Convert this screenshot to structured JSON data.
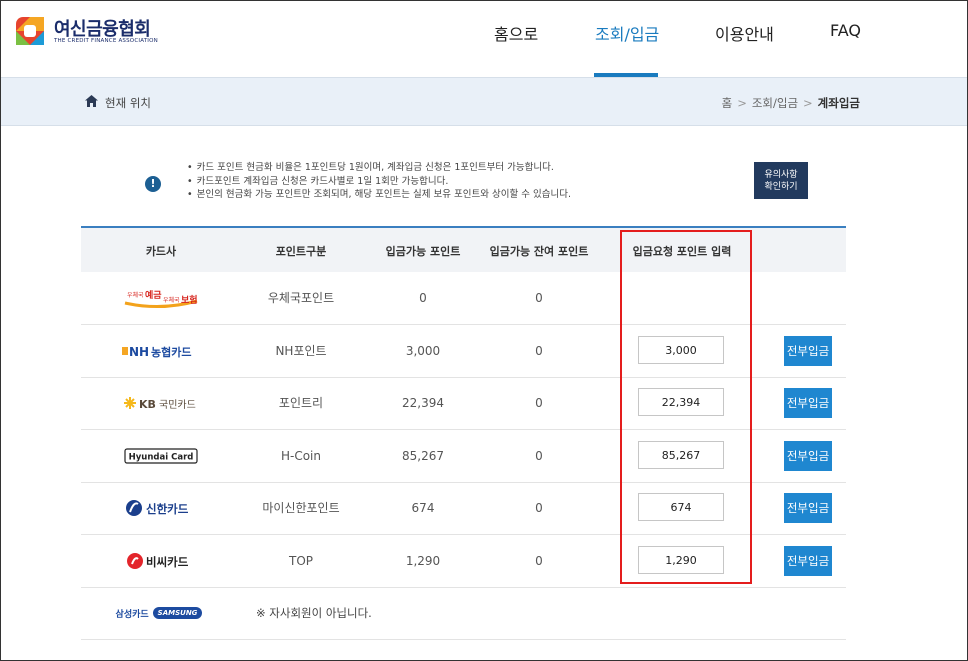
{
  "header": {
    "logo_text": "여신금융협회",
    "logo_sub": "THE CREDIT FINANCE ASSOCIATION",
    "nav": [
      {
        "label": "홈으로",
        "active": false
      },
      {
        "label": "조회/입금",
        "active": true
      },
      {
        "label": "이용안내",
        "active": false
      },
      {
        "label": "FAQ",
        "active": false
      }
    ],
    "accent_color": "#1a7bbf"
  },
  "breadcrumb": {
    "label": "현재 위치",
    "path": [
      "홈",
      "조회/입금",
      "계좌입금"
    ]
  },
  "notice": {
    "items": [
      "카드 포인트 현금화 비율은 1포인트당 1원이며, 계좌입금 신청은 1포인트부터 가능합니다.",
      "카드포인트 계좌입금 신청은 카드사별로 1일 1회만 가능합니다.",
      "본인의 현금화 가능 포인트만 조회되며, 해당 포인트는 실제 보유 포인트와 상이할 수 있습니다."
    ],
    "button_line1": "유의사항",
    "button_line2": "확인하기"
  },
  "table": {
    "headers": [
      "카드사",
      "포인트구분",
      "입금가능 포인트",
      "입금가능 잔여 포인트",
      "입금요청 포인트 입력"
    ],
    "all_deposit_label": "전부입금",
    "rows": [
      {
        "card": "우체국 예금 우체국 보험",
        "logo": "epost-logo",
        "type": "우체국포인트",
        "available": "0",
        "remaining": "0",
        "input": "",
        "has_action": false
      },
      {
        "card": "NH농협카드",
        "logo": "nh-logo",
        "type": "NH포인트",
        "available": "3,000",
        "remaining": "0",
        "input": "3,000",
        "has_action": true
      },
      {
        "card": "KB국민카드",
        "logo": "kb-logo",
        "type": "포인트리",
        "available": "22,394",
        "remaining": "0",
        "input": "22,394",
        "has_action": true
      },
      {
        "card": "Hyundai Card",
        "logo": "hyundai-logo",
        "type": "H-Coin",
        "available": "85,267",
        "remaining": "0",
        "input": "85,267",
        "has_action": true
      },
      {
        "card": "신한카드",
        "logo": "shinhan-logo",
        "type": "마이신한포인트",
        "available": "674",
        "remaining": "0",
        "input": "674",
        "has_action": true
      },
      {
        "card": "비씨카드",
        "logo": "bc-logo",
        "type": "TOP",
        "available": "1,290",
        "remaining": "0",
        "input": "1,290",
        "has_action": true
      }
    ],
    "samsung_row": {
      "card_ko": "삼성카드",
      "card_en": "SAMSUNG",
      "message": "※ 자사회원이 아닙니다."
    }
  },
  "colors": {
    "highlight_box": "#e41d1d",
    "button_blue": "#1f87d0",
    "notice_btn": "#223a5e"
  }
}
